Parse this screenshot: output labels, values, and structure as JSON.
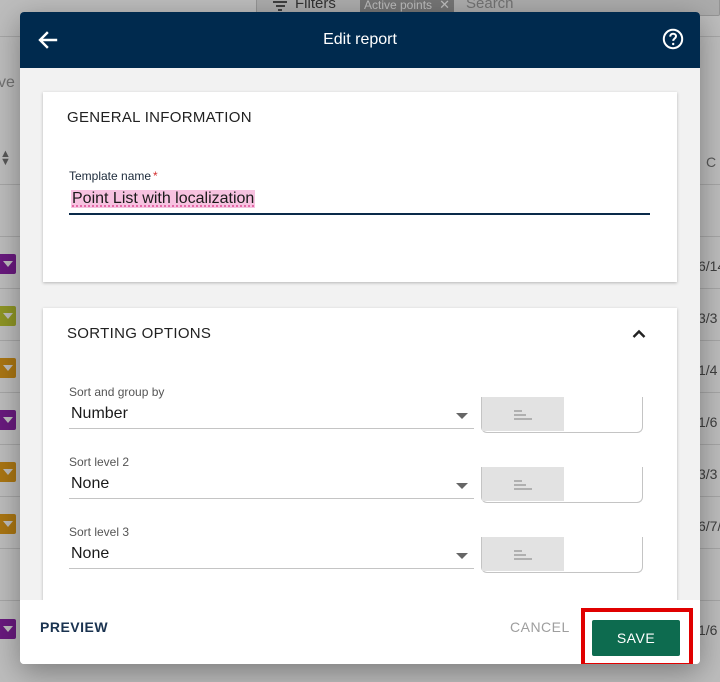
{
  "background": {
    "filters_label": "Filters",
    "chip_label": "Active points",
    "search_placeholder": "Search",
    "left_text": "ve",
    "column_label": "C",
    "dates": [
      "6/14",
      "3/3",
      "1/4",
      "1/6",
      "3/3",
      "6/7/",
      "1/6"
    ],
    "tag_colors": [
      "#8e24aa",
      "#c0ca33",
      "#e6a01a",
      "#8e24aa",
      "#e6a01a",
      "#e6a01a",
      "#8e24aa"
    ]
  },
  "dialog": {
    "title": "Edit report",
    "general": {
      "title": "GENERAL INFORMATION",
      "template_label": "Template name",
      "required_mark": "*",
      "template_value": "Point List with localization"
    },
    "sorting": {
      "title": "SORTING OPTIONS",
      "fields": [
        {
          "label": "Sort and group by",
          "value": "Number"
        },
        {
          "label": "Sort level 2",
          "value": "None"
        },
        {
          "label": "Sort level 3",
          "value": "None"
        }
      ]
    },
    "footer": {
      "preview": "PREVIEW",
      "cancel": "CANCEL",
      "save": "SAVE"
    }
  },
  "colors": {
    "header": "#002a4e",
    "save": "#0d6b4f",
    "highlight": "#e00000"
  }
}
